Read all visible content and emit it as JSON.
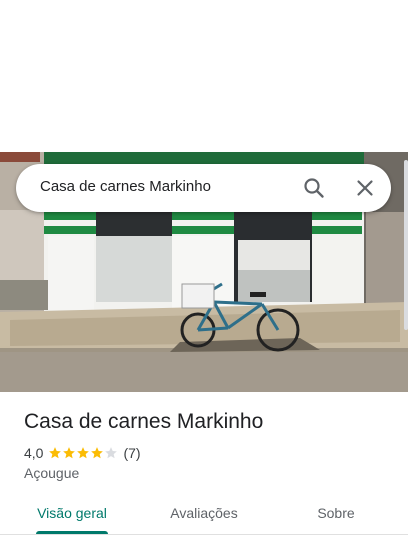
{
  "search": {
    "query": "Casa de carnes Markinho"
  },
  "place": {
    "name": "Casa de carnes Markinho",
    "rating": "4,0",
    "stars_filled": 4,
    "stars_total": 5,
    "review_count": "(7)",
    "category": "Açougue"
  },
  "tabs": [
    {
      "label": "Visão geral",
      "active": true
    },
    {
      "label": "Avaliações",
      "active": false
    },
    {
      "label": "Sobre",
      "active": false
    }
  ],
  "colors": {
    "accent": "#00796b",
    "star": "#fbbc04",
    "star_empty": "#dadce0"
  },
  "icons": {
    "search": "search-icon",
    "close": "close-icon"
  }
}
